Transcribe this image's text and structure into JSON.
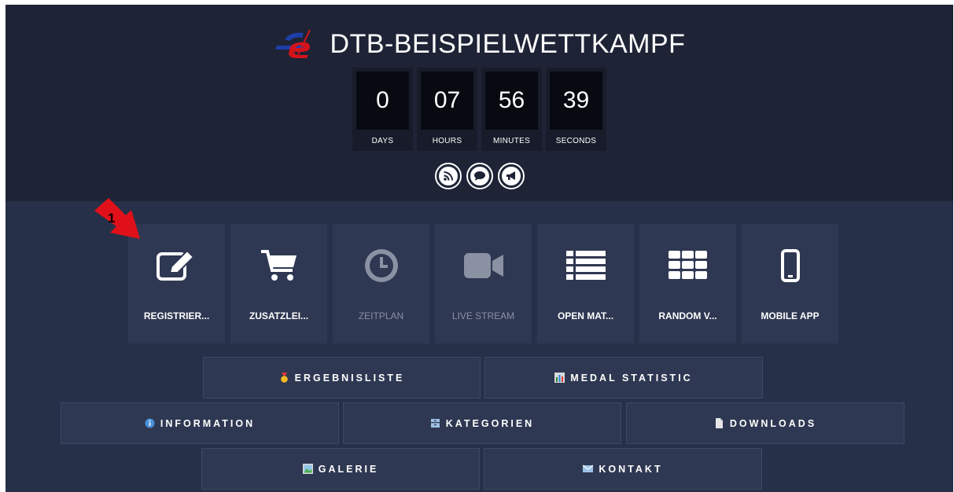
{
  "header": {
    "title": "DTB-BEISPIELWETTKAMPF"
  },
  "countdown": [
    {
      "value": "0",
      "label": "DAYS"
    },
    {
      "value": "07",
      "label": "HOURS"
    },
    {
      "value": "56",
      "label": "MINUTES"
    },
    {
      "value": "39",
      "label": "SECONDS"
    }
  ],
  "social_icons": [
    "rss-icon",
    "chat-icon",
    "megaphone-icon"
  ],
  "tiles": [
    {
      "label": "REGISTRIER...",
      "icon": "edit-icon",
      "enabled": true
    },
    {
      "label": "ZUSATZLEI...",
      "icon": "cart-icon",
      "enabled": true
    },
    {
      "label": "ZEITPLAN",
      "icon": "clock-icon",
      "enabled": false
    },
    {
      "label": "LIVE STREAM",
      "icon": "video-camera-icon",
      "enabled": false
    },
    {
      "label": "OPEN MAT...",
      "icon": "list-icon",
      "enabled": true
    },
    {
      "label": "RANDOM V...",
      "icon": "grid-icon",
      "enabled": true
    },
    {
      "label": "MOBILE APP",
      "icon": "mobile-phone-icon",
      "enabled": true
    }
  ],
  "buttons": {
    "ergebnisliste": "ERGEBNISLISTE",
    "medal_statistic": "MEDAL STATISTIC",
    "information": "INFORMATION",
    "kategorien": "KATEGORIEN",
    "downloads": "DOWNLOADS",
    "galerie": "GALERIE",
    "kontakt": "KONTAKT"
  },
  "annotation": {
    "number": "1",
    "color": "#e0101a"
  },
  "colors": {
    "header_bg": "#1e2336",
    "body_bg": "#273049",
    "tile_bg": "#2f3852",
    "logo_blue": "#1e3ea8",
    "logo_red": "#d3141c"
  }
}
